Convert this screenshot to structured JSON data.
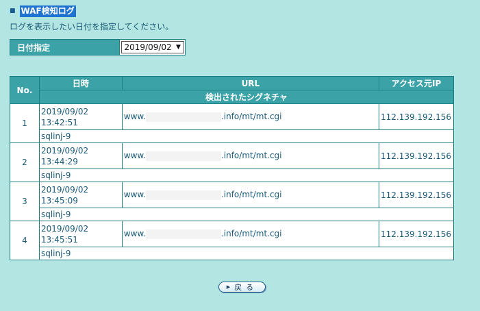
{
  "header": {
    "title": "WAF検知ログ",
    "subtitle": "ログを表示したい日付を指定してください。"
  },
  "date_picker": {
    "label": "日付指定",
    "selected": "2019/09/02"
  },
  "table": {
    "headers": {
      "no": "No.",
      "datetime": "日時",
      "url": "URL",
      "ip": "アクセス元IP",
      "signature": "検出されたシグネチャ"
    },
    "rows": [
      {
        "no": "1",
        "date": "2019/09/02",
        "time": "13:42:51",
        "url_prefix": "www.",
        "url_suffix": ".info/mt/mt.cgi",
        "ip": "112.139.192.156",
        "signature": "sqlinj-9"
      },
      {
        "no": "2",
        "date": "2019/09/02",
        "time": "13:44:29",
        "url_prefix": "www.",
        "url_suffix": ".info/mt/mt.cgi",
        "ip": "112.139.192.156",
        "signature": "sqlinj-9"
      },
      {
        "no": "3",
        "date": "2019/09/02",
        "time": "13:45:09",
        "url_prefix": "www.",
        "url_suffix": ".info/mt/mt.cgi",
        "ip": "112.139.192.156",
        "signature": "sqlinj-9"
      },
      {
        "no": "4",
        "date": "2019/09/02",
        "time": "13:45:51",
        "url_prefix": "www.",
        "url_suffix": ".info/mt/mt.cgi",
        "ip": "112.139.192.156",
        "signature": "sqlinj-9"
      }
    ]
  },
  "back_button": {
    "label": "戻る",
    "icon": "play-triangle-icon"
  }
}
